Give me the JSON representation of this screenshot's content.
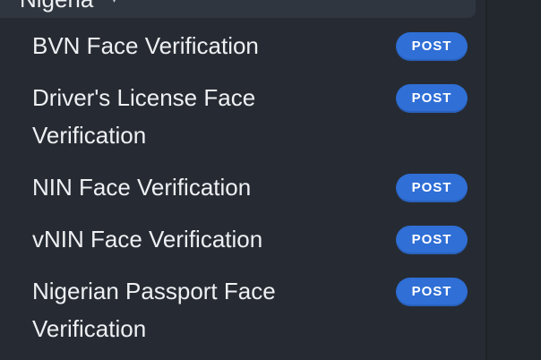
{
  "group": {
    "title": "Nigeria"
  },
  "items": [
    {
      "label": "BVN Face Verification",
      "method": "POST"
    },
    {
      "label": "Driver's License Face Verification",
      "method": "POST"
    },
    {
      "label": "NIN Face Verification",
      "method": "POST"
    },
    {
      "label": "vNIN Face Verification",
      "method": "POST"
    },
    {
      "label": "Nigerian Passport Face Verification",
      "method": "POST"
    }
  ],
  "colors": {
    "background": "#262b33",
    "badge": "#2f6fd6",
    "text": "#eef0f3"
  },
  "icons": {
    "group_toggle": "chevron-down-icon"
  }
}
